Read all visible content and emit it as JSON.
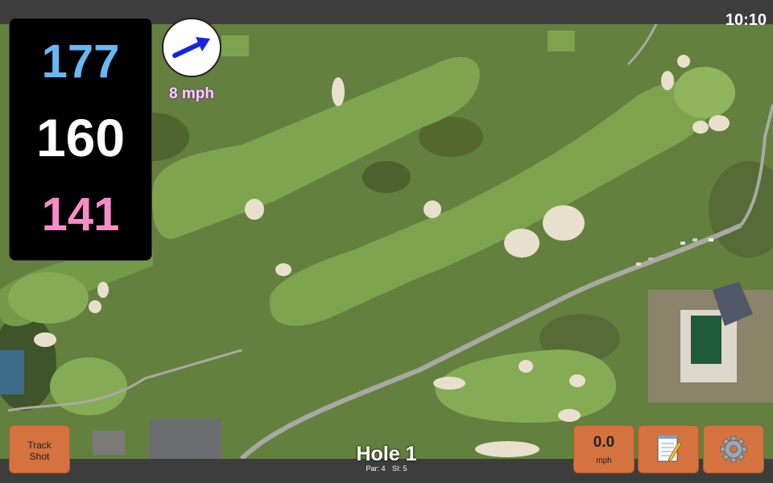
{
  "status_bar": {
    "time": "10:10"
  },
  "distances": {
    "back": "177",
    "middle": "160",
    "front": "141"
  },
  "wind": {
    "speed_label": "8 mph",
    "direction": "arrow-right-icon"
  },
  "buttons": {
    "track_shot_line1": "Track",
    "track_shot_line2": "Shot",
    "shot_speed_value": "0.0",
    "shot_speed_unit": "mph",
    "notes_icon": "notepad-icon",
    "settings_icon": "gear-icon"
  },
  "hole": {
    "title": "Hole 1",
    "par": "Par: 4",
    "stroke_index": "SI: 5"
  },
  "colors": {
    "back_distance": "#69b7f5",
    "middle_distance": "#ffffff",
    "front_distance": "#f78cc8",
    "button": "#d4733f",
    "bar": "#3d3d3d"
  }
}
